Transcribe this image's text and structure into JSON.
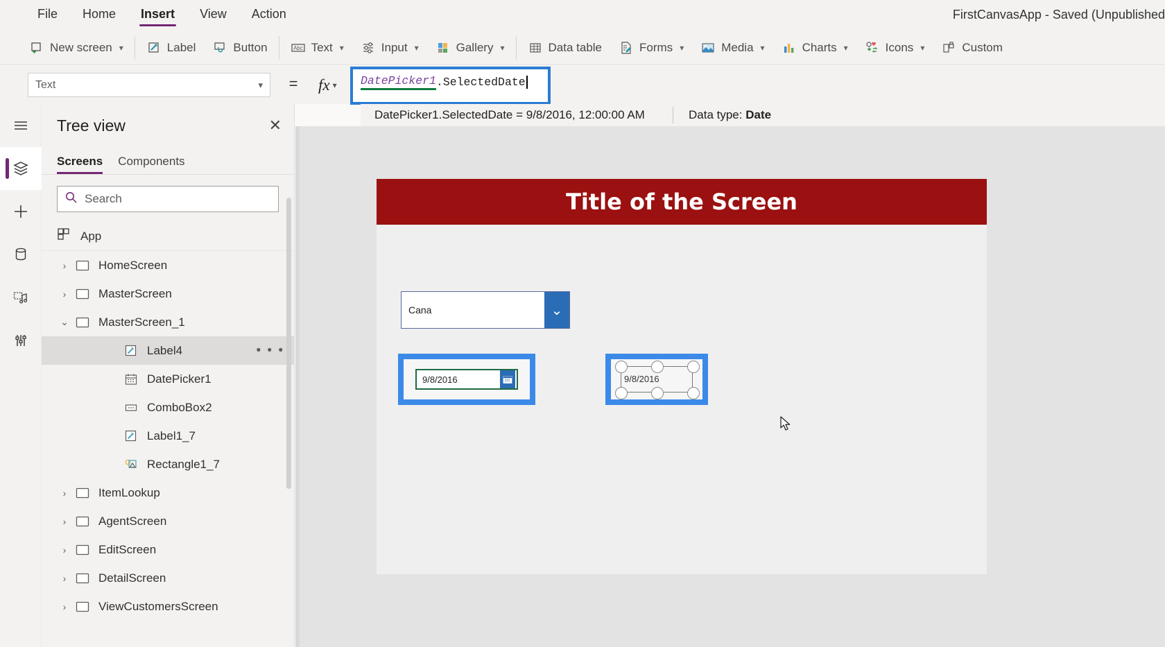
{
  "menubar": {
    "items": [
      {
        "label": "File",
        "active": false
      },
      {
        "label": "Home",
        "active": false
      },
      {
        "label": "Insert",
        "active": true
      },
      {
        "label": "View",
        "active": false
      },
      {
        "label": "Action",
        "active": false
      }
    ],
    "app_title": "FirstCanvasApp - Saved (Unpublished"
  },
  "ribbon": {
    "items": [
      {
        "label": "New screen",
        "icon": "new-screen-icon",
        "chevron": true
      },
      {
        "label": "Label",
        "icon": "label-icon",
        "chevron": false
      },
      {
        "label": "Button",
        "icon": "button-icon",
        "chevron": false
      },
      {
        "label": "Text",
        "icon": "text-icon",
        "chevron": true
      },
      {
        "label": "Input",
        "icon": "input-icon",
        "chevron": true
      },
      {
        "label": "Gallery",
        "icon": "gallery-icon",
        "chevron": true
      },
      {
        "label": "Data table",
        "icon": "data-table-icon",
        "chevron": false
      },
      {
        "label": "Forms",
        "icon": "forms-icon",
        "chevron": true
      },
      {
        "label": "Media",
        "icon": "media-icon",
        "chevron": true
      },
      {
        "label": "Charts",
        "icon": "charts-icon",
        "chevron": true
      },
      {
        "label": "Icons",
        "icon": "icons-icon",
        "chevron": true
      },
      {
        "label": "Custom",
        "icon": "custom-icon",
        "chevron": false
      }
    ]
  },
  "formula_bar": {
    "property_selected": "Text",
    "equals": "=",
    "fx_label": "fx",
    "formula": {
      "control_token": "DatePicker1",
      "dot": ".",
      "property_token": "SelectedDate"
    },
    "intellisense": {
      "expression": "DatePicker1.SelectedDate  =  9/8/2016, 12:00:00 AM",
      "data_type_label": "Data type:",
      "data_type_value": "Date"
    }
  },
  "rail": {
    "items": [
      {
        "name": "hamburger-menu-icon",
        "selected": false
      },
      {
        "name": "tree-view-icon",
        "selected": true
      },
      {
        "name": "insert-plus-icon",
        "selected": false
      },
      {
        "name": "data-sources-icon",
        "selected": false
      },
      {
        "name": "media-library-icon",
        "selected": false
      },
      {
        "name": "advanced-tools-icon",
        "selected": false
      }
    ]
  },
  "tree_panel": {
    "title": "Tree view",
    "close_label": "✕",
    "tabs": [
      {
        "label": "Screens",
        "active": true
      },
      {
        "label": "Components",
        "active": false
      }
    ],
    "search_placeholder": "Search",
    "app_node": {
      "label": "App",
      "icon": "app-icon"
    },
    "nodes": [
      {
        "label": "HomeScreen",
        "icon": "screen-icon",
        "level": 0,
        "expanded": false,
        "chevron": "›",
        "selected": false,
        "more": false
      },
      {
        "label": "MasterScreen",
        "icon": "screen-icon",
        "level": 0,
        "expanded": false,
        "chevron": "›",
        "selected": false,
        "more": false
      },
      {
        "label": "MasterScreen_1",
        "icon": "screen-icon",
        "level": 0,
        "expanded": true,
        "chevron": "⌄",
        "selected": false,
        "more": false
      },
      {
        "label": "Label4",
        "icon": "label-control-icon",
        "level": 1,
        "expanded": false,
        "chevron": "",
        "selected": true,
        "more": true
      },
      {
        "label": "DatePicker1",
        "icon": "datepicker-control-icon",
        "level": 1,
        "expanded": false,
        "chevron": "",
        "selected": false,
        "more": false
      },
      {
        "label": "ComboBox2",
        "icon": "combobox-control-icon",
        "level": 1,
        "expanded": false,
        "chevron": "",
        "selected": false,
        "more": false
      },
      {
        "label": "Label1_7",
        "icon": "label-control-icon",
        "level": 1,
        "expanded": false,
        "chevron": "",
        "selected": false,
        "more": false
      },
      {
        "label": "Rectangle1_7",
        "icon": "rectangle-control-icon",
        "level": 1,
        "expanded": false,
        "chevron": "",
        "selected": false,
        "more": false
      },
      {
        "label": "ItemLookup",
        "icon": "screen-icon",
        "level": 0,
        "expanded": false,
        "chevron": "›",
        "selected": false,
        "more": false
      },
      {
        "label": "AgentScreen",
        "icon": "screen-icon",
        "level": 0,
        "expanded": false,
        "chevron": "›",
        "selected": false,
        "more": false
      },
      {
        "label": "EditScreen",
        "icon": "screen-icon",
        "level": 0,
        "expanded": false,
        "chevron": "›",
        "selected": false,
        "more": false
      },
      {
        "label": "DetailScreen",
        "icon": "screen-icon",
        "level": 0,
        "expanded": false,
        "chevron": "›",
        "selected": false,
        "more": false
      },
      {
        "label": "ViewCustomersScreen",
        "icon": "screen-icon",
        "level": 0,
        "expanded": false,
        "chevron": "›",
        "selected": false,
        "more": false
      }
    ],
    "more_dots": "• • •"
  },
  "canvas": {
    "screen_title": "Title of the Screen",
    "title_bg_color": "#9b1010",
    "screen_bg_color": "#efefef",
    "combobox": {
      "value": "Cana",
      "chevron": "⌄"
    },
    "datepicker": {
      "value": "9/8/2016",
      "calendar_icon": "calendar-icon"
    },
    "selected_label": {
      "value": "9/8/2016"
    },
    "selection_color": "#3b8ae8"
  }
}
